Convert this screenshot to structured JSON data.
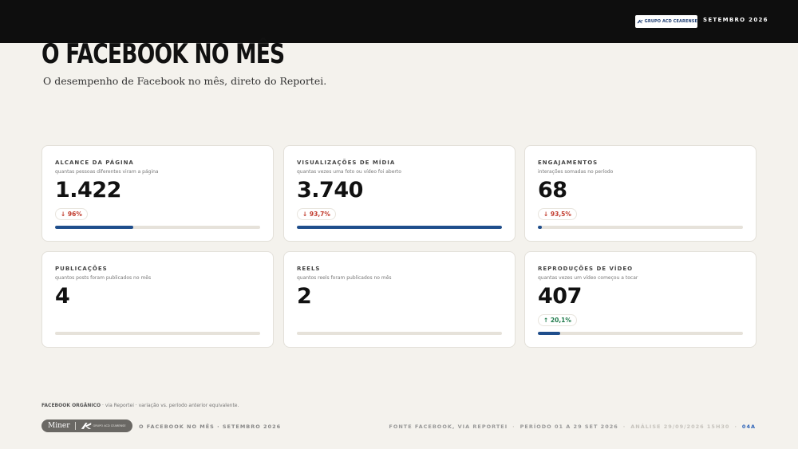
{
  "header": {
    "brand_logo_text": "GRUPO ACD CEARENSE",
    "period": "SETEMBRO 2026"
  },
  "page": {
    "title": "O FACEBOOK NO MÊS",
    "subtitle": "O desempenho de Facebook no mês, direto do Reportei."
  },
  "colors": {
    "accent_bar": "#1f4e8c",
    "down": "#c0392b",
    "up": "#1e7a4a",
    "page_number": "#2e64b8"
  },
  "cards": [
    {
      "label": "ALCANCE DA PÁGINA",
      "description": "quantas pessoas diferentes viram a página",
      "value": "1.422",
      "change": "↓ 96%",
      "direction": "down",
      "progress": 0.38
    },
    {
      "label": "VISUALIZAÇÕES DE MÍDIA",
      "description": "quantas vezes uma foto ou vídeo foi aberto",
      "value": "3.740",
      "change": "↓ 93,7%",
      "direction": "down",
      "progress": 1.0
    },
    {
      "label": "ENGAJAMENTOS",
      "description": "interações somadas no período",
      "value": "68",
      "change": "↓ 93,5%",
      "direction": "down",
      "progress": 0.02
    },
    {
      "label": "PUBLICAÇÕES",
      "description": "quantos posts foram publicados no mês",
      "value": "4",
      "change": "",
      "direction": "none",
      "progress": 0.0
    },
    {
      "label": "REELS",
      "description": "quantos reels foram publicados no mês",
      "value": "2",
      "change": "",
      "direction": "none",
      "progress": 0.0
    },
    {
      "label": "REPRODUÇÕES DE VÍDEO",
      "description": "quantas vezes um vídeo começou a tocar",
      "value": "407",
      "change": "↑ 20,1%",
      "direction": "up",
      "progress": 0.11
    }
  ],
  "footnote": {
    "source": "FACEBOOK ORGÂNICO",
    "text": " · via Reportei · variação vs. período anterior equivalente."
  },
  "footer": {
    "logo_text": "Miner",
    "logo_partner": "GRUPO ACD CEARENSE",
    "left": "O FACEBOOK NO MÊS · SETEMBRO 2026",
    "source": "FONTE FACEBOOK, VIA REPORTEI",
    "period": "PERÍODO 01 A 29 SET 2026",
    "analysis": "ANÁLISE 29/09/2026 15H30",
    "page_number": "04A"
  }
}
